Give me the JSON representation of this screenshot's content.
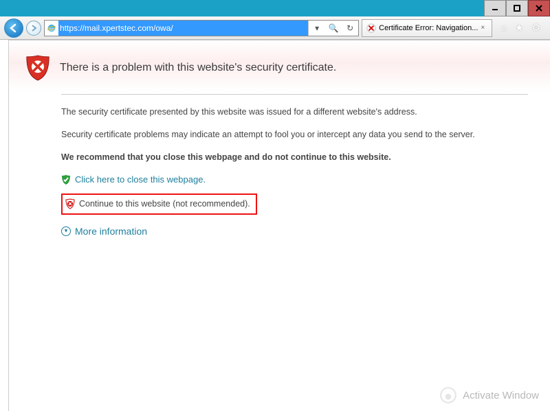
{
  "window": {
    "min": "minimize",
    "max": "maximize",
    "close": "close"
  },
  "nav": {
    "back": "Back",
    "forward": "Forward",
    "url": "https://mail.xpertstec.com/owa/",
    "search": "🔍",
    "refresh": "↻",
    "dropdown": "▾"
  },
  "tab": {
    "title": "Certificate Error: Navigation...",
    "close": "×"
  },
  "toolbar": {
    "home": "⌂",
    "fav": "★",
    "gear": "⚙"
  },
  "page": {
    "title": "There is a problem with this website's security certificate.",
    "p1": "The security certificate presented by this website was issued for a different website's address.",
    "p2": "Security certificate problems may indicate an attempt to fool you or intercept any data you send to the server.",
    "rec": "We recommend that you close this webpage and do not continue to this website.",
    "close_link": "Click here to close this webpage.",
    "continue_link": "Continue to this website (not recommended).",
    "more": "More information"
  },
  "watermark": "Activate Window"
}
